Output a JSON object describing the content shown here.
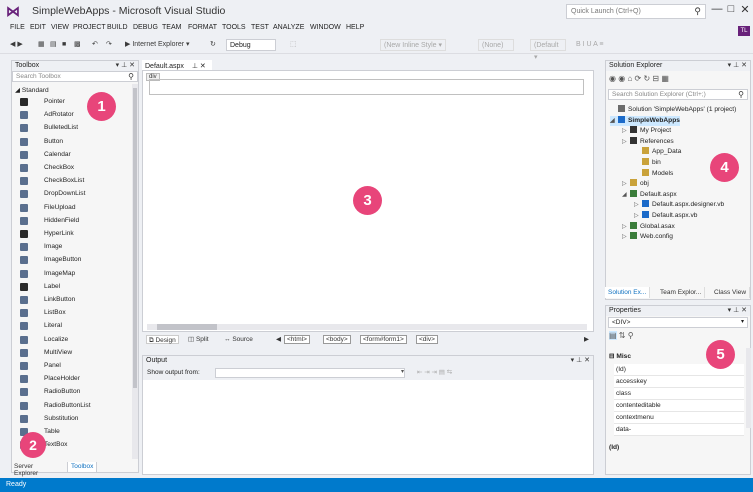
{
  "window": {
    "title": "SimpleWebApps - Microsoft Visual Studio",
    "quick_launch_placeholder": "Quick Launch (Ctrl+Q)",
    "controls": [
      "—",
      "□",
      "✕"
    ],
    "user_initials": "TL"
  },
  "menu": [
    "FILE",
    "EDIT",
    "VIEW",
    "PROJECT",
    "BUILD",
    "DEBUG",
    "TEAM",
    "FORMAT",
    "TOOLS",
    "TEST",
    "ANALYZE",
    "WINDOW",
    "HELP"
  ],
  "toolbar": {
    "run_label": "▶ Internet Explorer ▾",
    "config_value": "Debug",
    "inline_style": "(New Inline Style ▾",
    "none_value": "(None)",
    "default_value": "(Default ▾",
    "format_buttons": "B  I  U  A  ≡"
  },
  "toolbox": {
    "title": "Toolbox",
    "search_placeholder": "Search Toolbox",
    "category": "◢ Standard",
    "items": [
      "Pointer",
      "AdRotator",
      "BulletedList",
      "Button",
      "Calendar",
      "CheckBox",
      "CheckBoxList",
      "DropDownList",
      "FileUpload",
      "HiddenField",
      "HyperLink",
      "Image",
      "ImageButton",
      "ImageMap",
      "Label",
      "LinkButton",
      "ListBox",
      "Literal",
      "Localize",
      "MultiView",
      "Panel",
      "PlaceHolder",
      "RadioButton",
      "RadioButtonList",
      "Substitution",
      "Table",
      "TextBox"
    ],
    "bottom_tabs": [
      "Server Explorer",
      "Toolbox"
    ]
  },
  "editor": {
    "tab_label": "Default.aspx",
    "div_tag": "div",
    "view_buttons": [
      "Design",
      "Split",
      "Source"
    ],
    "breadcrumb_tags": [
      "<html>",
      "<body>",
      "<form#form1>",
      "<div>"
    ]
  },
  "output": {
    "title": "Output",
    "show_from_label": "Show output from:"
  },
  "solution_explorer": {
    "title": "Solution Explorer",
    "search_placeholder": "Search Solution Explorer (Ctrl+;)",
    "items": [
      {
        "label": "Solution 'SimpleWebApps' (1 project)",
        "indent": 0,
        "arrow": "",
        "color": "#6b6b6b"
      },
      {
        "label": "SimpleWebApps",
        "indent": 0,
        "arrow": "◢",
        "color": "#1b6ac9",
        "bold": true,
        "selected": true
      },
      {
        "label": "My Project",
        "indent": 1,
        "arrow": "▷",
        "color": "#333"
      },
      {
        "label": "References",
        "indent": 1,
        "arrow": "▷",
        "color": "#333"
      },
      {
        "label": "App_Data",
        "indent": 2,
        "arrow": "",
        "color": "#c9a23a"
      },
      {
        "label": "bin",
        "indent": 2,
        "arrow": "",
        "color": "#c9a23a"
      },
      {
        "label": "Models",
        "indent": 2,
        "arrow": "",
        "color": "#c9a23a"
      },
      {
        "label": "obj",
        "indent": 1,
        "arrow": "▷",
        "color": "#c9a23a"
      },
      {
        "label": "Default.aspx",
        "indent": 1,
        "arrow": "◢",
        "color": "#3b7d3b"
      },
      {
        "label": "Default.aspx.designer.vb",
        "indent": 2,
        "arrow": "▷",
        "color": "#1b6ac9"
      },
      {
        "label": "Default.aspx.vb",
        "indent": 2,
        "arrow": "▷",
        "color": "#1b6ac9"
      },
      {
        "label": "Global.asax",
        "indent": 1,
        "arrow": "▷",
        "color": "#3b7d3b"
      },
      {
        "label": "Web.config",
        "indent": 1,
        "arrow": "▷",
        "color": "#3b7d3b"
      }
    ],
    "tabs": [
      "Solution Ex...",
      "Team Explor...",
      "Class View"
    ]
  },
  "properties": {
    "title": "Properties",
    "selected_object": "<DIV>",
    "category": "⊟ Misc",
    "rows": [
      "(Id)",
      "accesskey",
      "class",
      "contenteditable",
      "contextmenu",
      "data-"
    ],
    "description_label": "(Id)"
  },
  "status_bar": {
    "text": "Ready"
  },
  "callouts": [
    "1",
    "2",
    "3",
    "4",
    "5"
  ]
}
